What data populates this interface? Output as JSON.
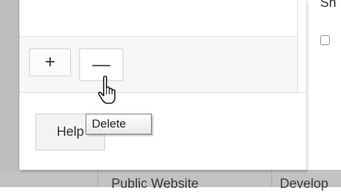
{
  "background": {
    "right_panel_text": "Sh",
    "table_row": [
      "Public Website",
      "Develop"
    ]
  },
  "list_toolbar": {
    "add_label": "+",
    "remove_label": "—"
  },
  "dialog_footer": {
    "help_label": "Help"
  },
  "tooltip": {
    "text": "Delete"
  },
  "cursor": {
    "icon": "hand-pointer-icon"
  }
}
